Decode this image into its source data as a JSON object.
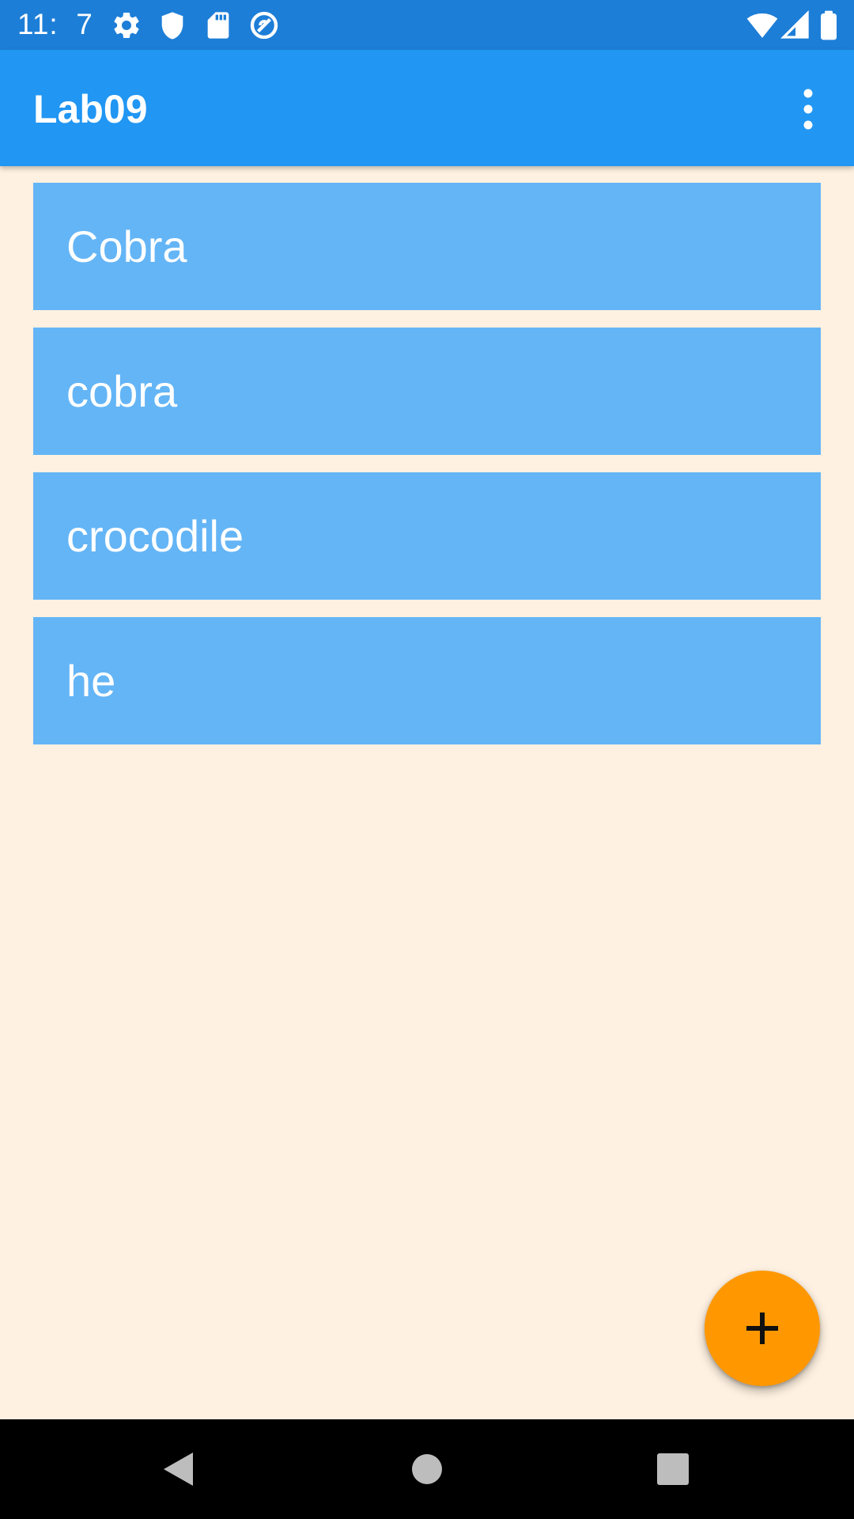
{
  "status_bar": {
    "time": "11:  7",
    "icons": [
      "gear-icon",
      "shield-icon",
      "sd-card-icon",
      "sync-disabled-icon",
      "wifi-icon",
      "cell-signal-icon",
      "battery-icon"
    ]
  },
  "app_bar": {
    "title": "Lab09",
    "menu_icon": "more-vert-icon"
  },
  "list": {
    "items": [
      {
        "label": "Cobra"
      },
      {
        "label": "cobra"
      },
      {
        "label": "crocodile"
      },
      {
        "label": "he"
      }
    ]
  },
  "fab": {
    "icon": "add-icon"
  },
  "nav_bar": {
    "icons": [
      "back-icon",
      "home-icon",
      "recents-icon"
    ]
  },
  "colors": {
    "status_bar": "#1D7ED7",
    "app_bar": "#2196F3",
    "list_item": "#64B5F6",
    "background": "#FEF1E1",
    "fab": "#FF9800"
  }
}
